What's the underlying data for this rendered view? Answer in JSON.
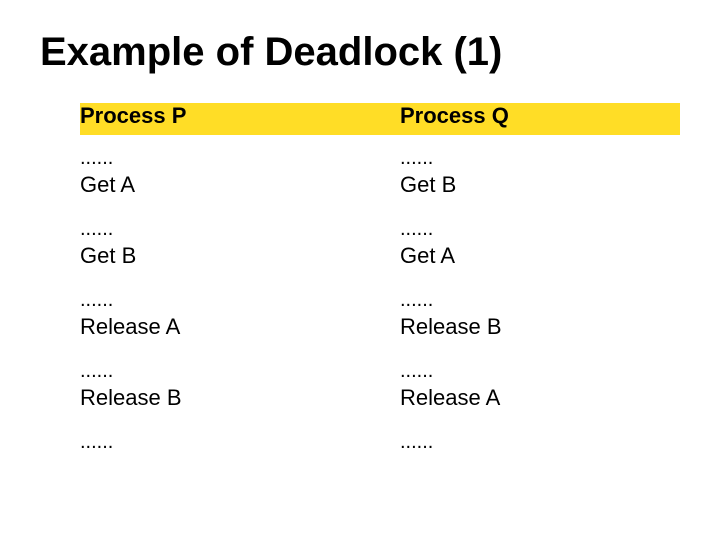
{
  "title": "Example of Deadlock (1)",
  "columns": [
    {
      "id": "process-p",
      "header": "Process P",
      "entries": [
        {
          "dots": "......",
          "action": "Get A"
        },
        {
          "dots": "......",
          "action": "Get B"
        },
        {
          "dots": "......",
          "action": "Release A"
        },
        {
          "dots": "......",
          "action": "Release B"
        },
        {
          "dots": "......"
        }
      ]
    },
    {
      "id": "process-q",
      "header": "Process Q",
      "entries": [
        {
          "dots": "......",
          "action": "Get B"
        },
        {
          "dots": "......",
          "action": "Get A"
        },
        {
          "dots": "......",
          "action": "Release B"
        },
        {
          "dots": "......",
          "action": "Release A"
        },
        {
          "dots": "......"
        }
      ]
    }
  ],
  "highlight_color": "#FFD700"
}
